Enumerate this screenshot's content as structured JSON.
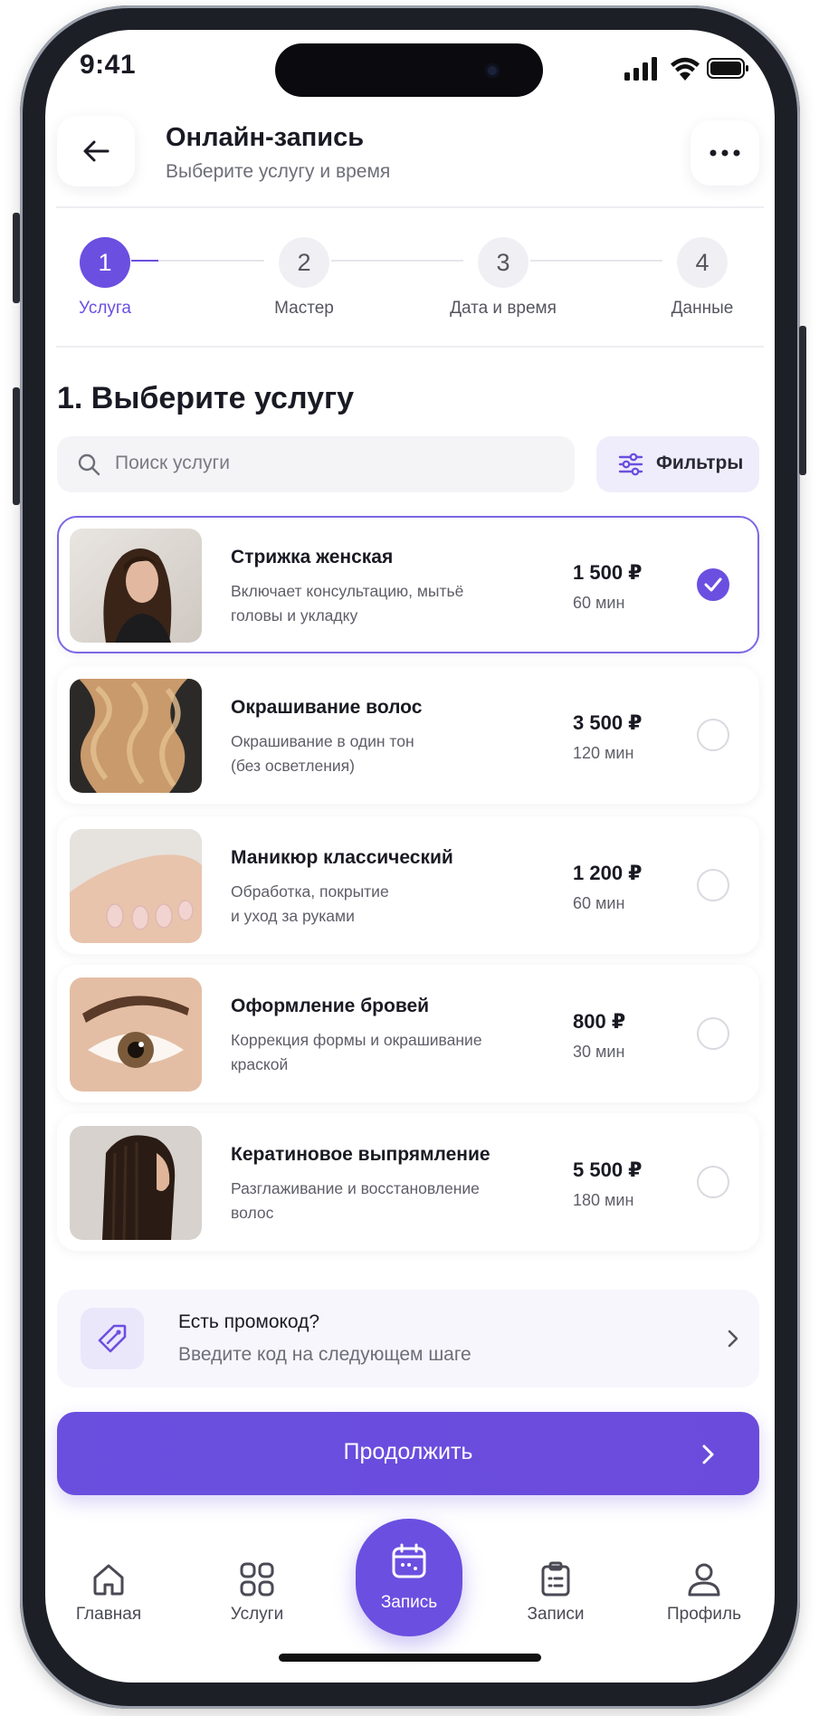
{
  "status_bar": {
    "time": "9:41"
  },
  "header": {
    "title": "Онлайн-запись",
    "subtitle": "Выберите услугу и время"
  },
  "stepper": {
    "current": 1,
    "steps": [
      {
        "number": "1",
        "label": "Услуга"
      },
      {
        "number": "2",
        "label": "Мастер"
      },
      {
        "number": "3",
        "label": "Дата и время"
      },
      {
        "number": "4",
        "label": "Данные"
      }
    ]
  },
  "section_title": "1. Выберите услугу",
  "search": {
    "placeholder": "Поиск услуги"
  },
  "filters_label": "Фильтры",
  "services": [
    {
      "name": "Стрижка женская",
      "desc1": "Включает консультацию, мытьё",
      "desc2": "головы и укладку",
      "price": "1 500 ₽",
      "duration": "60 мин",
      "selected": true,
      "image": "woman-brown-wavy-hair-photo"
    },
    {
      "name": "Окрашивание волос",
      "desc1": "Окрашивание в один тон",
      "desc2": "(без осветления)",
      "price": "3 500 ₽",
      "duration": "120 мин",
      "selected": false,
      "image": "blonde-curls-photo"
    },
    {
      "name": "Маникюр классический",
      "desc1": "Обработка, покрытие",
      "desc2": "и уход за руками",
      "price": "1 200 ₽",
      "duration": "60 мин",
      "selected": false,
      "image": "manicured-hand-photo"
    },
    {
      "name": "Оформление бровей",
      "desc1": "Коррекция формы и окрашивание",
      "desc2": "краской",
      "price": "800 ₽",
      "duration": "30 мин",
      "selected": false,
      "image": "eye-brow-closeup-photo"
    },
    {
      "name": "Кератиновое выпрямление",
      "desc1": "Разглаживание и восстановление",
      "desc2": "волос",
      "price": "5 500 ₽",
      "duration": "180 мин",
      "selected": false,
      "image": "woman-straight-hair-photo"
    }
  ],
  "promo": {
    "title": "Есть промокод?",
    "subtitle": "Введите код на следующем шаге"
  },
  "cta_label": "Продолжить",
  "tabbar": {
    "items": [
      {
        "label": "Главная",
        "icon": "home-icon"
      },
      {
        "label": "Услуги",
        "icon": "grid-icon"
      },
      {
        "label": "Запись",
        "icon": "calendar-icon",
        "active": true
      },
      {
        "label": "Записи",
        "icon": "clipboard-icon"
      },
      {
        "label": "Профиль",
        "icon": "user-icon"
      }
    ]
  },
  "colors": {
    "accent": "#6b4fe0",
    "accent_soft": "#efedfb",
    "text": "#1a1a24",
    "muted": "#6e6e78"
  }
}
